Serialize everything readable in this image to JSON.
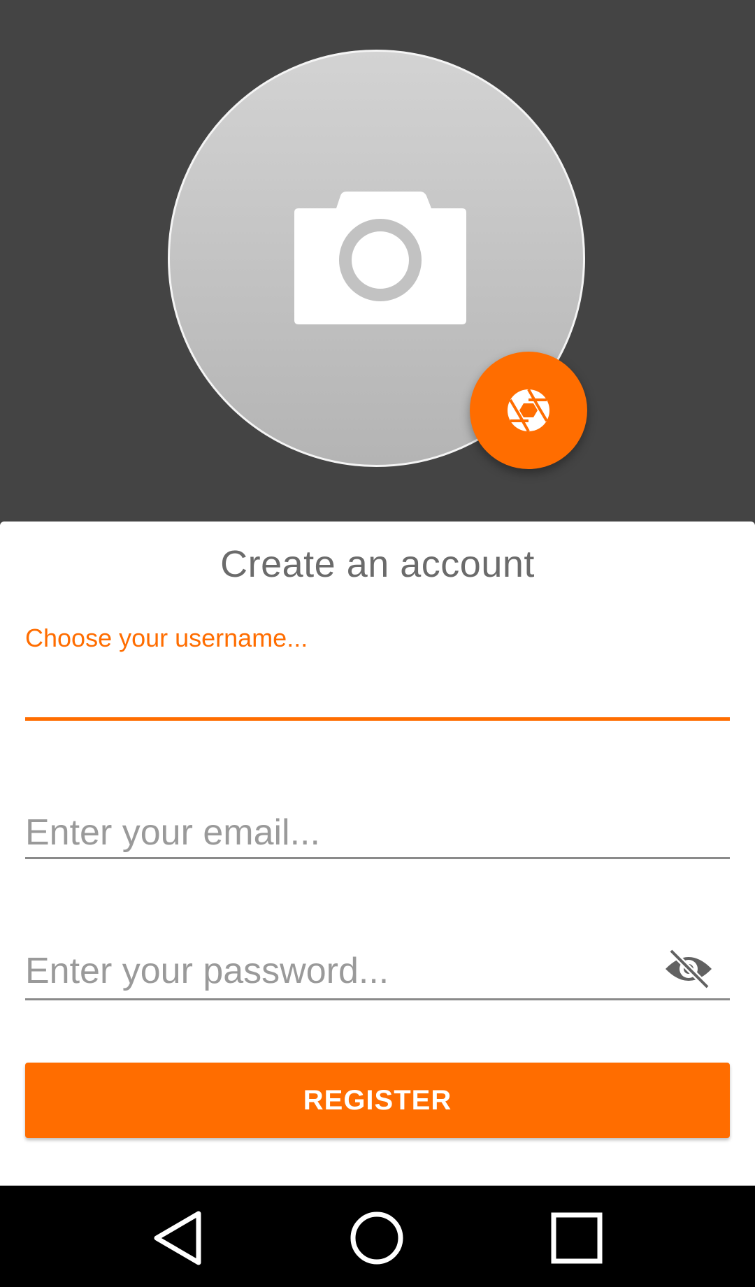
{
  "form": {
    "title": "Create an account",
    "username": {
      "label": "Choose your username...",
      "value": ""
    },
    "email": {
      "placeholder": "Enter your email...",
      "value": ""
    },
    "password": {
      "placeholder": "Enter your password...",
      "value": ""
    },
    "register_label": "REGISTER"
  },
  "icons": {
    "avatar_placeholder": "camera-icon",
    "photo_button": "shutter-icon",
    "password_toggle": "eye-off-icon",
    "nav": [
      "back-icon",
      "home-icon",
      "recents-icon"
    ]
  },
  "colors": {
    "accent": "#ff6d00",
    "header_background": "#444444",
    "card_background": "#ffffff",
    "title_text": "#6b6b6b",
    "placeholder_text": "#9a9a9a",
    "navbar_background": "#000000"
  }
}
